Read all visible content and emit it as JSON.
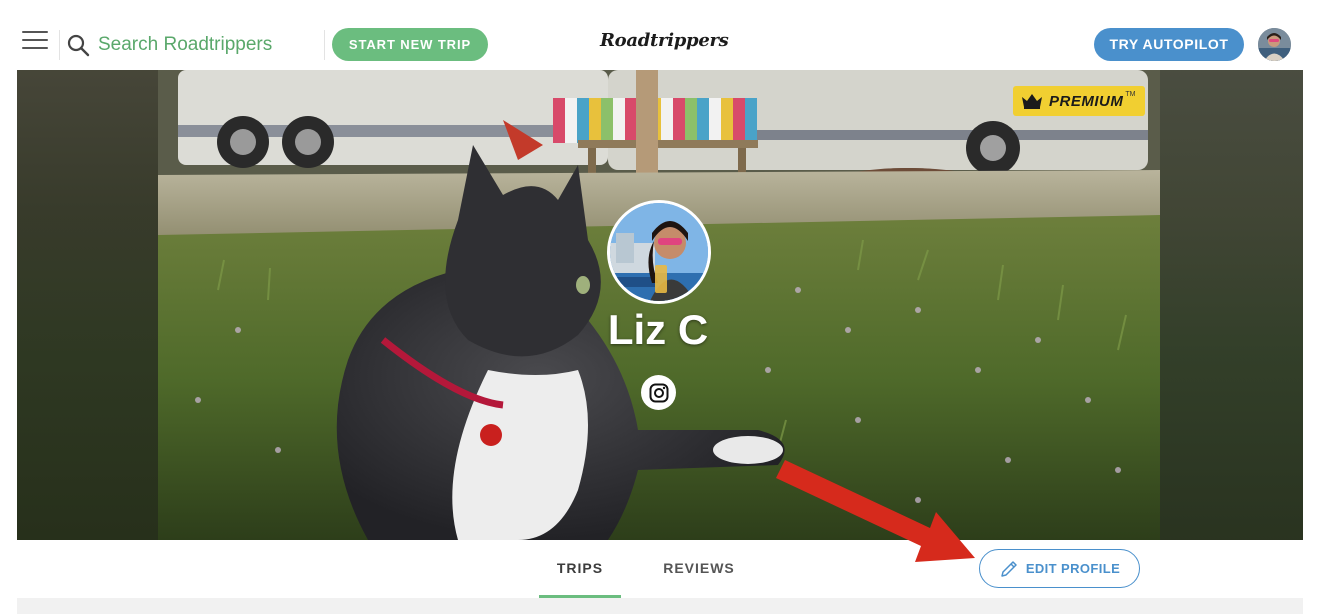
{
  "nav": {
    "search_placeholder": "Search Roadtrippers",
    "start_trip_label": "START NEW TRIP",
    "logo_text": "Roadtrippers",
    "autopilot_label": "TRY AUTOPILOT"
  },
  "profile": {
    "premium_label": "PREMIUM",
    "premium_tm": "TM",
    "name": "Liz C"
  },
  "tabs": [
    {
      "label": "TRIPS",
      "active": true
    },
    {
      "label": "REVIEWS",
      "active": false
    }
  ],
  "edit_profile_label": "EDIT PROFILE",
  "colors": {
    "accent_green": "#6bbd7f",
    "accent_blue": "#4a90cc",
    "premium_yellow": "#f1cf31",
    "annotation_red": "#d62a1c"
  },
  "icons": {
    "menu": "hamburger-menu-icon",
    "search": "search-icon",
    "premium": "crown-icon",
    "social": "instagram-icon",
    "edit": "pencil-icon"
  }
}
